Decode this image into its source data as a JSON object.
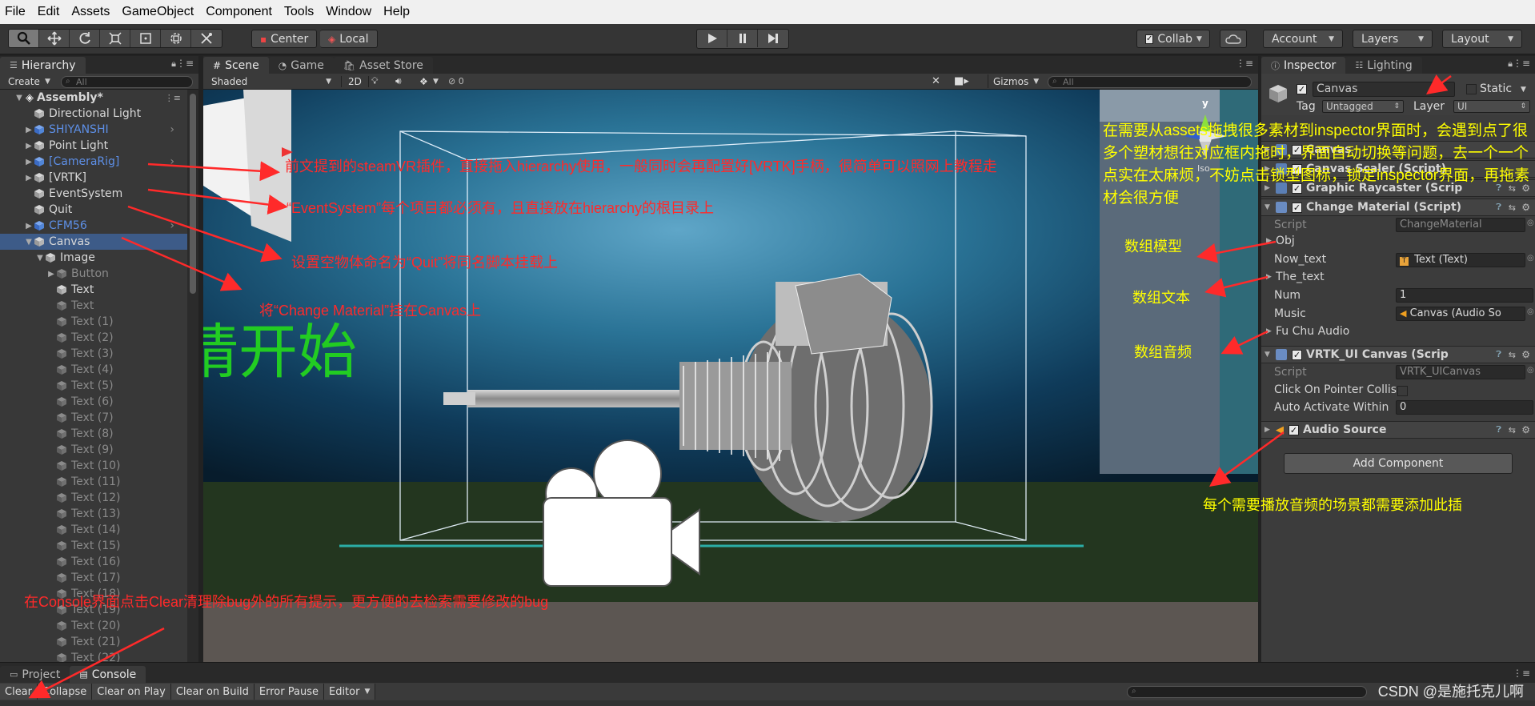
{
  "menu": [
    "File",
    "Edit",
    "Assets",
    "GameObject",
    "Component",
    "Tools",
    "Window",
    "Help"
  ],
  "toolbar": {
    "pivot": "Center",
    "space": "Local",
    "collab": "Collab",
    "account": "Account",
    "layers": "Layers",
    "layout": "Layout"
  },
  "hierarchy": {
    "tab": "Hierarchy",
    "create": "Create",
    "search_placeholder": "All",
    "scene_name": "Assembly*",
    "items": [
      {
        "label": "Directional Light",
        "indent": 1,
        "arrow": "",
        "style": "normal"
      },
      {
        "label": "SHIYANSHI",
        "indent": 1,
        "arrow": "▶",
        "style": "blue"
      },
      {
        "label": "Point Light",
        "indent": 1,
        "arrow": "▶",
        "style": "normal"
      },
      {
        "label": "[CameraRig]",
        "indent": 1,
        "arrow": "▶",
        "style": "blue"
      },
      {
        "label": "[VRTK]",
        "indent": 1,
        "arrow": "▶",
        "style": "normal"
      },
      {
        "label": "EventSystem",
        "indent": 1,
        "arrow": "",
        "style": "normal"
      },
      {
        "label": "Quit",
        "indent": 1,
        "arrow": "",
        "style": "normal"
      },
      {
        "label": "CFM56",
        "indent": 1,
        "arrow": "▶",
        "style": "blue"
      },
      {
        "label": "Canvas",
        "indent": 1,
        "arrow": "▼",
        "style": "selected"
      },
      {
        "label": "Image",
        "indent": 2,
        "arrow": "▼",
        "style": "normal"
      },
      {
        "label": "Button",
        "indent": 3,
        "arrow": "▶",
        "style": "dim"
      },
      {
        "label": "Text",
        "indent": 3,
        "arrow": "",
        "style": "normal"
      },
      {
        "label": "Text",
        "indent": 3,
        "arrow": "",
        "style": "dim"
      },
      {
        "label": "Text (1)",
        "indent": 3,
        "arrow": "",
        "style": "dim"
      },
      {
        "label": "Text (2)",
        "indent": 3,
        "arrow": "",
        "style": "dim"
      },
      {
        "label": "Text (3)",
        "indent": 3,
        "arrow": "",
        "style": "dim"
      },
      {
        "label": "Text (4)",
        "indent": 3,
        "arrow": "",
        "style": "dim"
      },
      {
        "label": "Text (5)",
        "indent": 3,
        "arrow": "",
        "style": "dim"
      },
      {
        "label": "Text (6)",
        "indent": 3,
        "arrow": "",
        "style": "dim"
      },
      {
        "label": "Text (7)",
        "indent": 3,
        "arrow": "",
        "style": "dim"
      },
      {
        "label": "Text (8)",
        "indent": 3,
        "arrow": "",
        "style": "dim"
      },
      {
        "label": "Text (9)",
        "indent": 3,
        "arrow": "",
        "style": "dim"
      },
      {
        "label": "Text (10)",
        "indent": 3,
        "arrow": "",
        "style": "dim"
      },
      {
        "label": "Text (11)",
        "indent": 3,
        "arrow": "",
        "style": "dim"
      },
      {
        "label": "Text (12)",
        "indent": 3,
        "arrow": "",
        "style": "dim"
      },
      {
        "label": "Text (13)",
        "indent": 3,
        "arrow": "",
        "style": "dim"
      },
      {
        "label": "Text (14)",
        "indent": 3,
        "arrow": "",
        "style": "dim"
      },
      {
        "label": "Text (15)",
        "indent": 3,
        "arrow": "",
        "style": "dim"
      },
      {
        "label": "Text (16)",
        "indent": 3,
        "arrow": "",
        "style": "dim"
      },
      {
        "label": "Text (17)",
        "indent": 3,
        "arrow": "",
        "style": "dim"
      },
      {
        "label": "Text (18)",
        "indent": 3,
        "arrow": "",
        "style": "dim"
      },
      {
        "label": "Text (19)",
        "indent": 3,
        "arrow": "",
        "style": "dim"
      },
      {
        "label": "Text (20)",
        "indent": 3,
        "arrow": "",
        "style": "dim"
      },
      {
        "label": "Text (21)",
        "indent": 3,
        "arrow": "",
        "style": "dim"
      },
      {
        "label": "Text (22)",
        "indent": 3,
        "arrow": "",
        "style": "dim"
      }
    ]
  },
  "scene": {
    "tabs": [
      "Scene",
      "Game",
      "Asset Store"
    ],
    "shading": "Shaded",
    "mode_2d": "2D",
    "fx_count": "0",
    "gizmos": "Gizmos",
    "search_placeholder": "All",
    "ui_text": "请开始",
    "axis_y": "y",
    "persp": "Iso"
  },
  "inspector": {
    "tabs": [
      "Inspector",
      "Lighting"
    ],
    "object_name": "Canvas",
    "static_label": "Static",
    "tag_label": "Tag",
    "tag_value": "Untagged",
    "layer_label": "Layer",
    "layer_value": "UI",
    "hidden_component_1": "Canvas",
    "hidden_component_2": "Canvas Scaler (Script)",
    "graphic_raycaster": "Graphic Raycaster (Scrip",
    "change_material": "Change Material (Script)",
    "script_label": "Script",
    "change_material_script": "ChangeMaterial",
    "obj_label": "Obj",
    "now_text_label": "Now_text",
    "now_text_value": "Text (Text)",
    "the_text_label": "The_text",
    "num_label": "Num",
    "num_value": "1",
    "music_label": "Music",
    "music_value": "Canvas (Audio So",
    "fu_chu_audio_label": "Fu Chu Audio",
    "vrtk_canvas": "VRTK_UI Canvas (Scrip",
    "vrtk_script": "VRTK_UICanvas",
    "click_label": "Click On Pointer Collis",
    "auto_label": "Auto Activate Within",
    "auto_value": "0",
    "audio_source": "Audio Source",
    "add_component": "Add Component"
  },
  "bottom": {
    "tabs": [
      "Project",
      "Console"
    ],
    "buttons": [
      "Clear",
      "Collapse",
      "Clear on Play",
      "Clear on Build",
      "Error Pause",
      "Editor"
    ]
  },
  "annotations": {
    "steamvr": "前文提到的steamVR插件，直接拖入hierarchy使用，一般同时会再配置好[VRTK]手柄，很简单可以照网上教程走",
    "eventsystem": "“EventSystem”每个项目都必须有，且直接放在hierarchy的根目录上",
    "quit": "设置空物体命名为“Quit”将同名脚本挂载上",
    "change_material": "将“Change Material”挂在Canvas上",
    "console": "在Console界面点击Clear清理除bug外的所有提示，更方便的去检索需要修改的bug",
    "inspector_tip": "在需要从assets拖拽很多素材到inspector界面时，会遇到点了很多个塑材想往对应框内拖时，界面自动切换等问题，去一个一个点实在太麻烦，不妨点击锁型图标，锁定inspector界面，再拖素材会很方便",
    "array_model": "数组模型",
    "array_text": "数组文本",
    "array_audio": "数组音频",
    "audio_tip": "每个需要播放音频的场景都需要添加此插"
  },
  "watermark": "CSDN @是施托克儿啊",
  "colors": {
    "selection": "#3d5b88",
    "annotation_red": "#ff2a2a",
    "annotation_yellow": "#ffff00",
    "ui_text_green": "#22cc22",
    "prefab_blue": "#5d8fe6"
  }
}
